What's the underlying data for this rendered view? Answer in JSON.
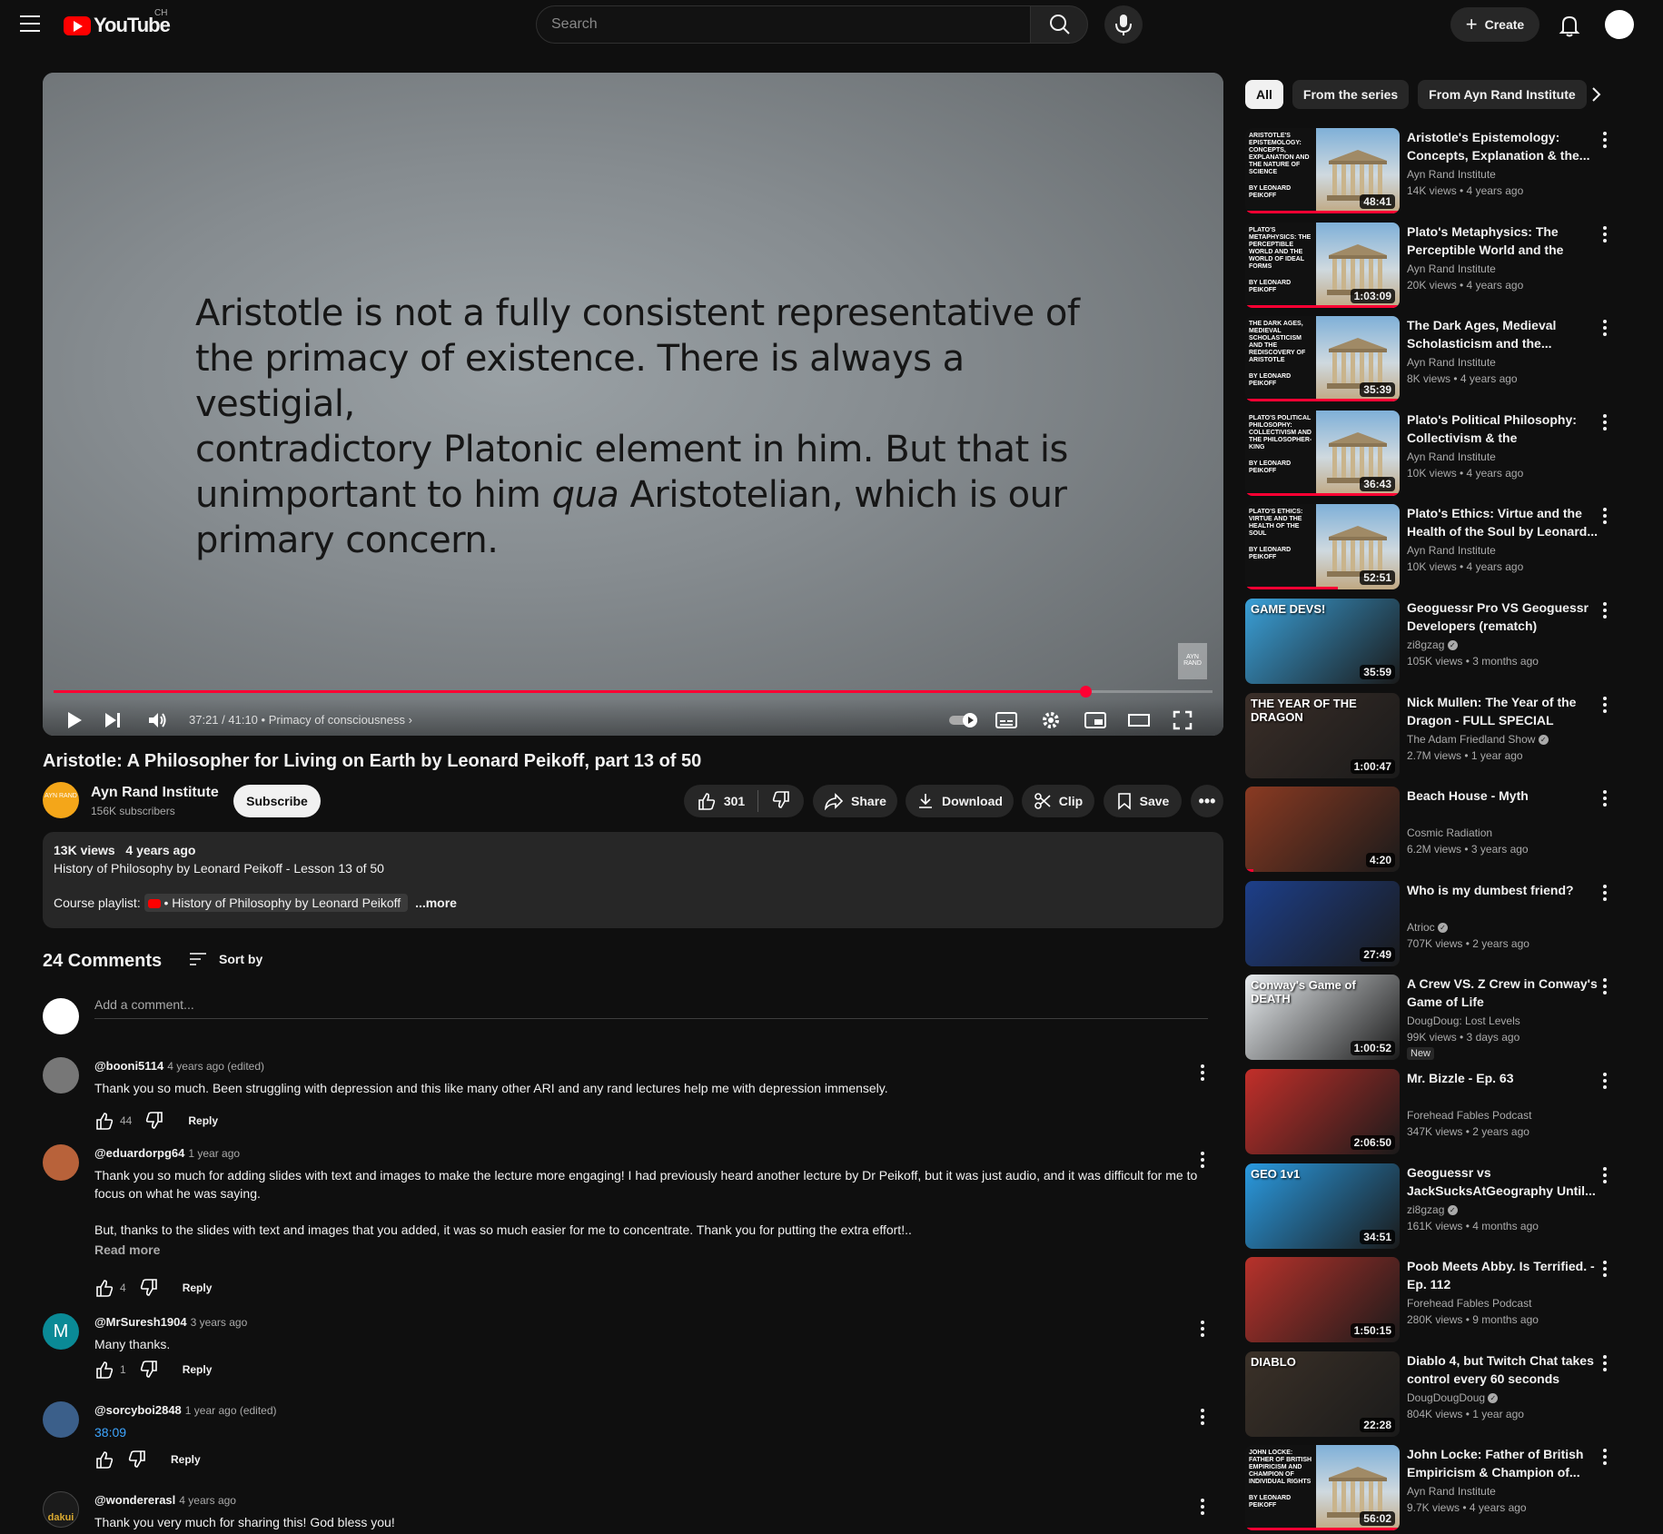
{
  "masthead": {
    "logo_text": "YouTube",
    "country_code": "CH",
    "search_placeholder": "Search",
    "create_label": "Create"
  },
  "player": {
    "slide_lines": [
      "Aristotle is not a fully consistent representative of",
      "the primacy of existence. There is always a vestigial,",
      "contradictory Platonic element in him. But that is"
    ],
    "slide_line4_pre": "unimportant to him ",
    "slide_line4_em": "qua",
    "slide_line4_post": " Aristotelian, which is our",
    "slide_line5": "primary concern.",
    "watermark": "AYN RAND",
    "time": "37:21 / 41:10",
    "chapter": "Primacy of consciousness",
    "progress": 0.89
  },
  "video": {
    "title": "Aristotle: A Philosopher for Living on Earth by Leonard Peikoff, part 13 of 50",
    "channel": "Ayn Rand Institute",
    "channel_avatar_text": "AYN RAND",
    "subscribers": "156K subscribers",
    "subscribe_label": "Subscribe",
    "likes": "301",
    "share_label": "Share",
    "download_label": "Download",
    "clip_label": "Clip",
    "save_label": "Save"
  },
  "description": {
    "views": "13K views",
    "age": "4 years ago",
    "text": "History of Philosophy by Leonard Peikoff - Lesson 13 of 50",
    "playlist_label": "Course playlist:",
    "playlist_link": "• History of Philosophy by Leonard Peikoff",
    "more_label": "...more"
  },
  "comments": {
    "count_label": "24 Comments",
    "sort_label": "Sort by",
    "add_placeholder": "Add a comment...",
    "items": [
      {
        "author": "@booni5114",
        "age": "4 years ago (edited)",
        "text": "Thank you so much. Been struggling with depression and this like many other ARI and any rand lectures help me with depression immensely.",
        "likes": "44",
        "reply": "Reply"
      },
      {
        "author": "@eduardorpg64",
        "age": "1 year ago",
        "text": "Thank you so much for adding slides with text and images to make the lecture more engaging! I had previously heard another lecture by Dr Peikoff, but it was just audio, and it was difficult for me to focus on what he was saying.",
        "text2": "But, thanks to the slides with text and images that you added, it was so much easier for me to concentrate. Thank you for putting the extra effort!..",
        "read_more": "Read more",
        "likes": "4",
        "reply": "Reply"
      },
      {
        "author": "@MrSuresh1904",
        "age": "3 years ago",
        "text": "Many thanks.",
        "likes": "1",
        "reply": "Reply",
        "avatar_letter": "M"
      },
      {
        "author": "@sorcyboi2848",
        "age": "1 year ago (edited)",
        "text": "38:09",
        "likes": "",
        "reply": "Reply"
      },
      {
        "author": "@wondererasl",
        "age": "4 years ago",
        "text": "Thank you very much for sharing this! God bless you!",
        "avatar_text": "dakui"
      }
    ]
  },
  "sidebar": {
    "chips": [
      "All",
      "From the series",
      "From Ayn Rand Institute"
    ],
    "items": [
      {
        "title": "Aristotle's Epistemology: Concepts, Explanation & the...",
        "channel": "Ayn Rand Institute",
        "stats": "14K views • 4 years ago",
        "duration": "48:41",
        "thumb_text": "ARISTOTLE'S EPISTEMOLOGY: CONCEPTS, EXPLANATION AND THE NATURE OF SCIENCE",
        "thumb_by": "BY LEONARD PEIKOFF",
        "watched": 1.0
      },
      {
        "title": "Plato's Metaphysics: The Perceptible World and the Wor...",
        "channel": "Ayn Rand Institute",
        "stats": "20K views • 4 years ago",
        "duration": "1:03:09",
        "thumb_text": "PLATO'S METAPHYSICS: THE PERCEPTIBLE WORLD AND THE WORLD OF IDEAL FORMS",
        "thumb_by": "BY LEONARD PEIKOFF",
        "watched": 1.0
      },
      {
        "title": "The Dark Ages, Medieval Scholasticism and the...",
        "channel": "Ayn Rand Institute",
        "stats": "8K views • 4 years ago",
        "duration": "35:39",
        "thumb_text": "THE DARK AGES, MEDIEVAL SCHOLASTICISM AND THE REDISCOVERY OF ARISTOTLE",
        "thumb_by": "BY LEONARD PEIKOFF",
        "watched": 1.0
      },
      {
        "title": "Plato's Political Philosophy: Collectivism & the Philosopher...",
        "channel": "Ayn Rand Institute",
        "stats": "10K views • 4 years ago",
        "duration": "36:43",
        "thumb_text": "PLATO'S POLITICAL PHILOSOPHY: COLLECTIVISM AND THE PHILOSOPHER-KING",
        "thumb_by": "BY LEONARD PEIKOFF",
        "watched": 1.0
      },
      {
        "title": "Plato's Ethics: Virtue and the Health of the Soul by Leonard...",
        "channel": "Ayn Rand Institute",
        "stats": "10K views • 4 years ago",
        "duration": "52:51",
        "thumb_text": "PLATO'S ETHICS: VIRTUE AND THE HEALTH OF THE SOUL",
        "thumb_by": "BY LEONARD PEIKOFF",
        "watched": 0.6
      },
      {
        "title": "Geoguessr Pro VS Geoguessr Developers (rematch)",
        "channel": "zi8gzag",
        "stats": "105K views • 3 months ago",
        "duration": "35:59",
        "thumb_text": "GAME DEVS!",
        "verified": true,
        "bg": "#3aa0d8"
      },
      {
        "title": "Nick Mullen: The Year of the Dragon - FULL SPECIAL",
        "channel": "The Adam Friedland Show",
        "stats": "2.7M views • 1 year ago",
        "duration": "1:00:47",
        "thumb_text": "THE YEAR OF THE DRAGON",
        "verified": true,
        "bg": "#3a2e28"
      },
      {
        "title": "Beach House - Myth",
        "channel": "Cosmic Radiation",
        "stats": "6.2M views • 3 years ago",
        "duration": "4:20",
        "bg": "#8a3a22",
        "watched": 0.05
      },
      {
        "title": "Who is my dumbest friend?",
        "channel": "Atrioc",
        "stats": "707K views • 2 years ago",
        "duration": "27:49",
        "verified": true,
        "bg": "#1d3f8a"
      },
      {
        "title": "A Crew VS. Z Crew in Conway's Game of Life",
        "channel": "DougDoug: Lost Levels",
        "stats": "99K views • 3 days ago",
        "duration": "1:00:52",
        "thumb_text": "Conway's Game of DEATH",
        "new_badge": "New",
        "bg": "#e8ecef"
      },
      {
        "title": "Mr. Bizzle - Ep. 63",
        "channel": "Forehead Fables Podcast",
        "stats": "347K views • 2 years ago",
        "duration": "2:06:50",
        "bg": "#c22f2a"
      },
      {
        "title": "Geoguessr vs JackSucksAtGeography Until...",
        "channel": "zi8gzag",
        "stats": "161K views • 4 months ago",
        "duration": "34:51",
        "thumb_text": "GEO 1v1",
        "verified": true,
        "bg": "#2a9ae0"
      },
      {
        "title": "Poob Meets Abby. Is Terrified. - Ep. 112",
        "channel": "Forehead Fables Podcast",
        "stats": "280K views • 9 months ago",
        "duration": "1:50:15",
        "bg": "#b8322b"
      },
      {
        "title": "Diablo 4, but Twitch Chat takes control every 60 seconds",
        "channel": "DougDougDoug",
        "stats": "804K views • 1 year ago",
        "duration": "22:28",
        "thumb_text": "DIABLO",
        "verified": true,
        "bg": "#3b3128"
      },
      {
        "title": "John Locke: Father of British Empiricism & Champion of...",
        "channel": "Ayn Rand Institute",
        "stats": "9.7K views • 4 years ago",
        "duration": "56:02",
        "thumb_text": "JOHN LOCKE: FATHER OF BRITISH EMPIRICISM AND CHAMPION OF INDIVIDUAL RIGHTS",
        "thumb_by": "BY LEONARD PEIKOFF",
        "watched": 1.0
      }
    ]
  }
}
